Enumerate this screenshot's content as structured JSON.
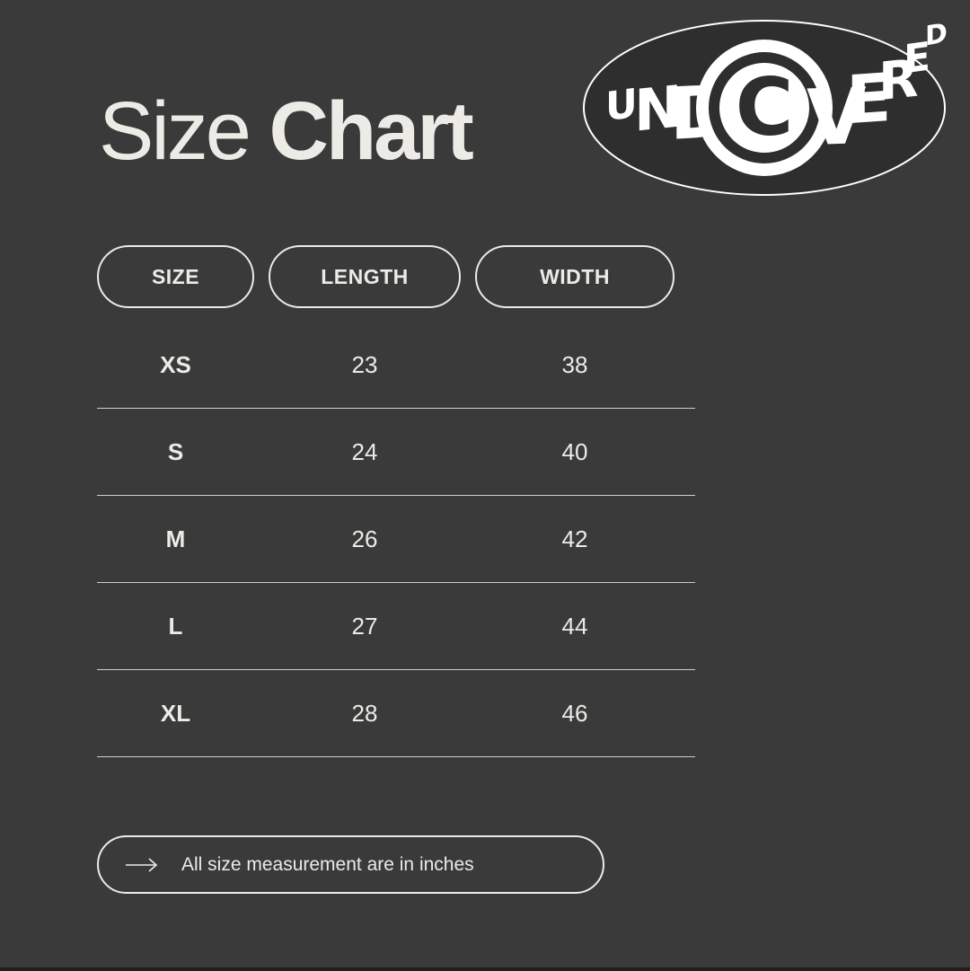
{
  "title": {
    "light": "Size",
    "bold": "Chart"
  },
  "logo": {
    "text": "UNDISCOVERED",
    "icon": "undiscovered-oval-logo"
  },
  "table": {
    "headers": [
      "SIZE",
      "LENGTH",
      "WIDTH"
    ],
    "rows": [
      {
        "size": "XS",
        "length": "23",
        "width": "38"
      },
      {
        "size": "S",
        "length": "24",
        "width": "40"
      },
      {
        "size": "M",
        "length": "26",
        "width": "42"
      },
      {
        "size": "L",
        "length": "27",
        "width": "44"
      },
      {
        "size": "XL",
        "length": "28",
        "width": "46"
      }
    ]
  },
  "note": {
    "icon": "arrow-right-icon",
    "text": "All size measurement are in inches"
  },
  "colors": {
    "background": "#3a3a3a",
    "foreground": "#ecebe6"
  }
}
